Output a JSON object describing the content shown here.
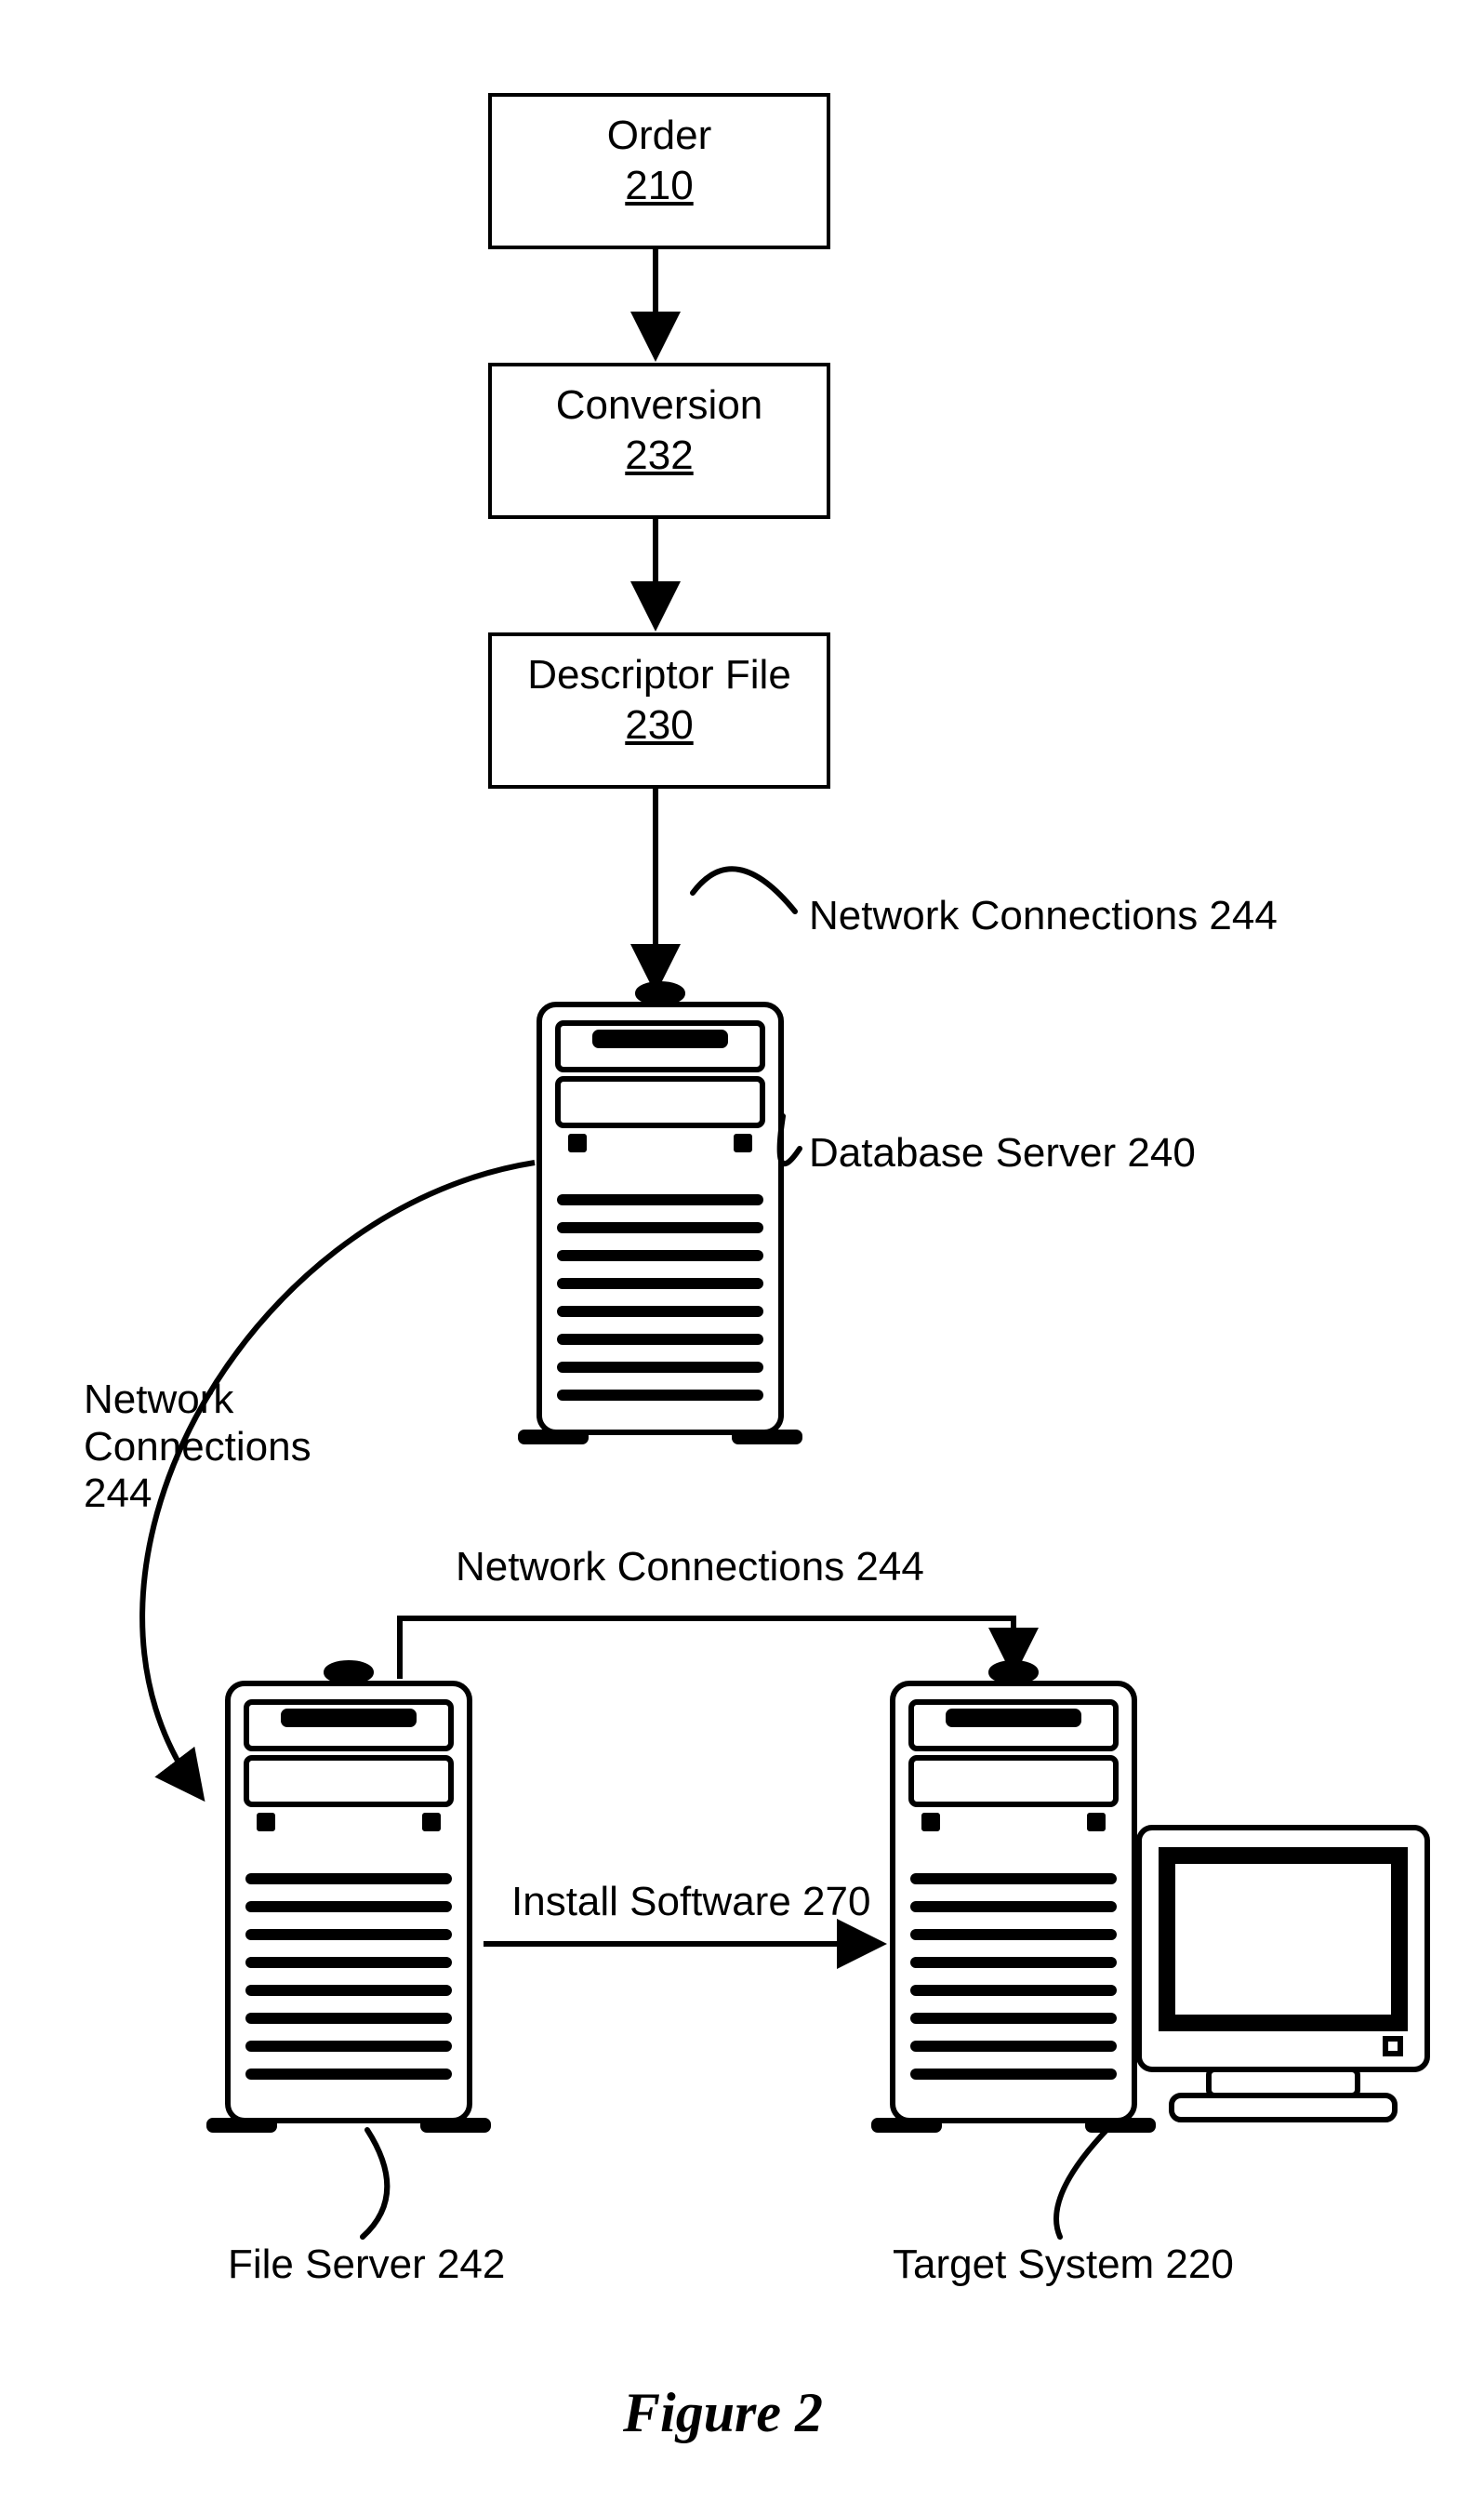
{
  "boxes": {
    "order": {
      "title": "Order",
      "num": "210"
    },
    "conversion": {
      "title": "Conversion",
      "num": "232"
    },
    "descriptor": {
      "title": "Descriptor File",
      "num": "230"
    }
  },
  "labels": {
    "netconn_top": "Network Connections 244",
    "dbserver": "Database Server 240",
    "netconn_left": "Network\nConnections\n244",
    "netconn_mid": "Network Connections 244",
    "install": "Install Software 270",
    "fileserver": "File Server 242",
    "targetsys": "Target System 220"
  },
  "figure": "Figure 2"
}
